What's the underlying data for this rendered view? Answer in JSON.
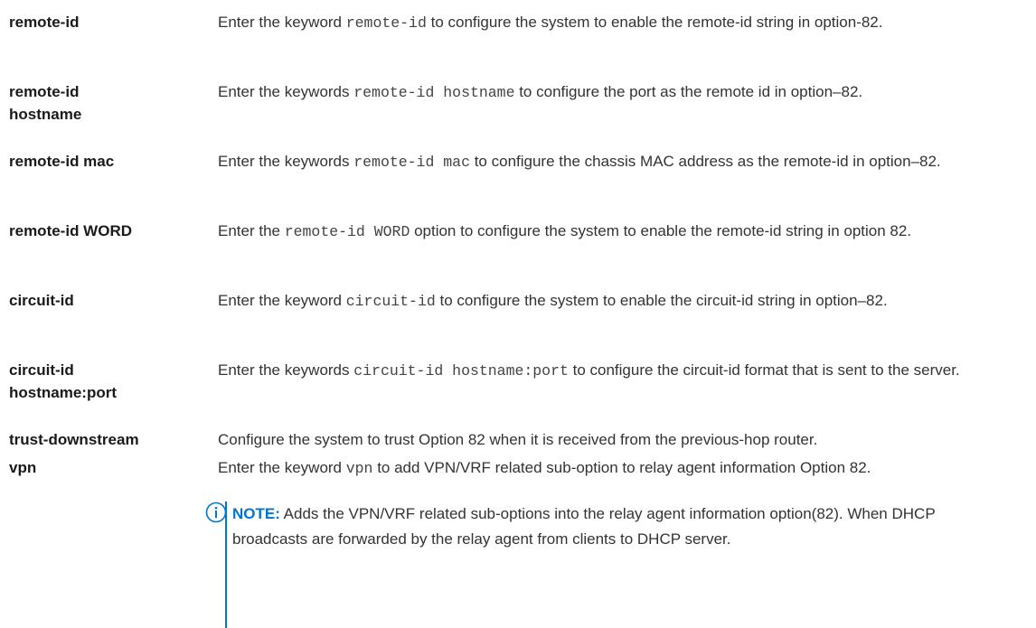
{
  "params": [
    {
      "term": "remote-id",
      "desc_pre": "Enter the keyword ",
      "code": "remote-id",
      "desc_post": " to configure the system to enable the remote-id string in option-82."
    },
    {
      "term": "remote-id hostname",
      "desc_pre": "Enter the keywords ",
      "code": "remote-id hostname",
      "desc_post": " to configure the port as the remote id in option–82."
    },
    {
      "term": "remote-id mac",
      "desc_pre": "Enter the keywords ",
      "code": "remote-id mac",
      "desc_post": " to configure the chassis MAC address as the remote-id in option–82."
    },
    {
      "term": "remote-id WORD",
      "desc_pre": "Enter the ",
      "code": "remote-id WORD",
      "desc_post": " option to configure the system to enable the remote-id string in option 82."
    },
    {
      "term": "circuit-id",
      "desc_pre": "Enter the keyword ",
      "code": "circuit-id",
      "desc_post": " to configure the system to enable the circuit-id string in option–82."
    },
    {
      "term": "circuit-id hostname:port",
      "desc_pre": "Enter the keywords ",
      "code": "circuit-id hostname:port",
      "desc_post": " to configure the circuit-id format that is sent to the server."
    },
    {
      "term": "trust-downstream",
      "desc_pre": "Configure the system to trust Option 82 when it is received from the previous-hop router.",
      "code": "",
      "desc_post": ""
    },
    {
      "term": "vpn",
      "desc_pre": "Enter the keyword ",
      "code": "vpn",
      "desc_post": " to add VPN/VRF related sub-option to relay agent information Option 82."
    }
  ],
  "note": {
    "label": "NOTE:",
    "text": " Adds the VPN/VRF related sub-options into the relay agent information option(82). When DHCP broadcasts are forwarded by the relay agent from clients to DHCP server.",
    "icon": "info-icon",
    "accent_color": "#0076ce"
  }
}
